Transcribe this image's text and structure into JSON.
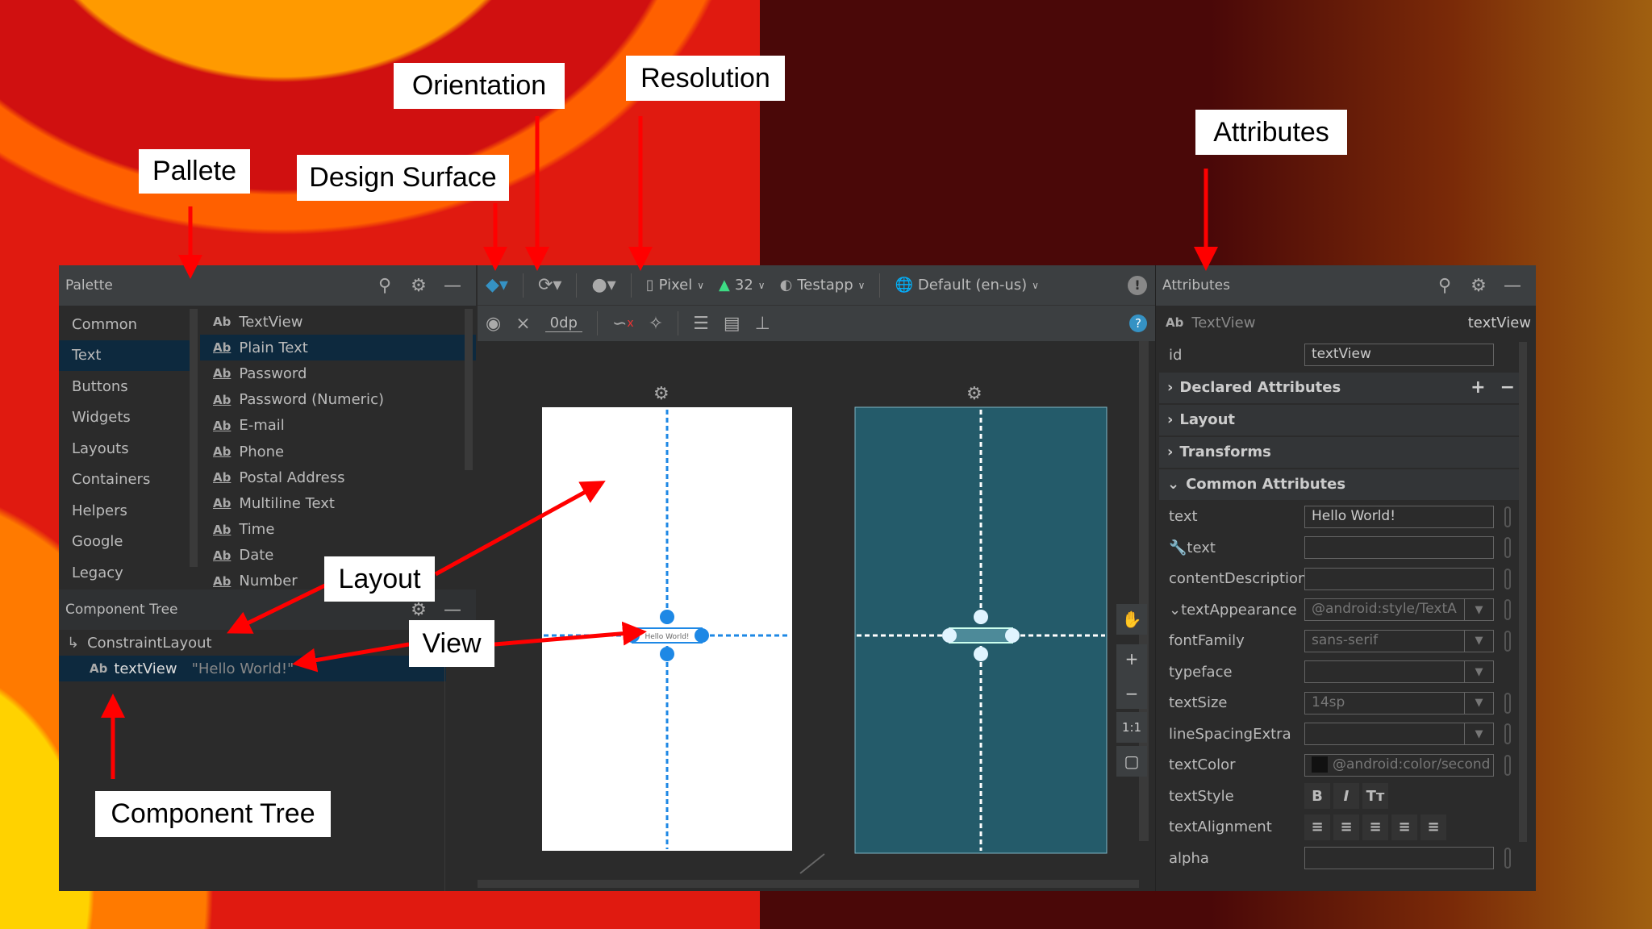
{
  "palette": {
    "title": "Palette",
    "categories": [
      "Common",
      "Text",
      "Buttons",
      "Widgets",
      "Layouts",
      "Containers",
      "Helpers",
      "Google",
      "Legacy"
    ],
    "selected_category": "Text",
    "items": [
      "TextView",
      "Plain Text",
      "Password",
      "Password (Numeric)",
      "E-mail",
      "Phone",
      "Postal Address",
      "Multiline Text",
      "Time",
      "Date",
      "Number"
    ],
    "selected_item": "Plain Text",
    "ab": "Ab"
  },
  "tree": {
    "title": "Component Tree",
    "root": "ConstraintLayout",
    "child": "textView",
    "child_text": "\"Hello World!\""
  },
  "toolbar": {
    "device": "Pixel",
    "api": "32",
    "theme": "Testapp",
    "locale": "Default (en-us)",
    "margin": "0dp"
  },
  "canvas": {
    "text": "Hello World!",
    "zoom_fit": "1:1"
  },
  "attributes": {
    "title": "Attributes",
    "type": "TextView",
    "id_name": "textView",
    "id_label": "id",
    "id_value": "textView",
    "sections": [
      "Declared Attributes",
      "Layout",
      "Transforms",
      "Common Attributes"
    ],
    "rows": [
      {
        "label": "text",
        "value": "Hello World!"
      },
      {
        "label": "text",
        "value": ""
      },
      {
        "label": "contentDescription",
        "value": ""
      },
      {
        "label": "textAppearance",
        "value": "@android:style/TextA"
      },
      {
        "label": "fontFamily",
        "value": "sans-serif"
      },
      {
        "label": "typeface",
        "value": ""
      },
      {
        "label": "textSize",
        "value": "14sp"
      },
      {
        "label": "lineSpacingExtra",
        "value": ""
      },
      {
        "label": "textColor",
        "value": "@android:color/second"
      },
      {
        "label": "textStyle"
      },
      {
        "label": "textAlignment"
      },
      {
        "label": "alpha",
        "value": ""
      }
    ]
  },
  "annotations": {
    "pallete": "Pallete",
    "design_surface": "Design Surface",
    "orientation": "Orientation",
    "resolution": "Resolution",
    "attributes": "Attributes",
    "layout": "Layout",
    "view": "View",
    "component_tree": "Component Tree"
  },
  "colors": {
    "accent": "#3592c4",
    "selection": "#0d293e",
    "blueprint": "#1e88e5",
    "teal": "#245b6a",
    "arrow": "#ff0000"
  }
}
